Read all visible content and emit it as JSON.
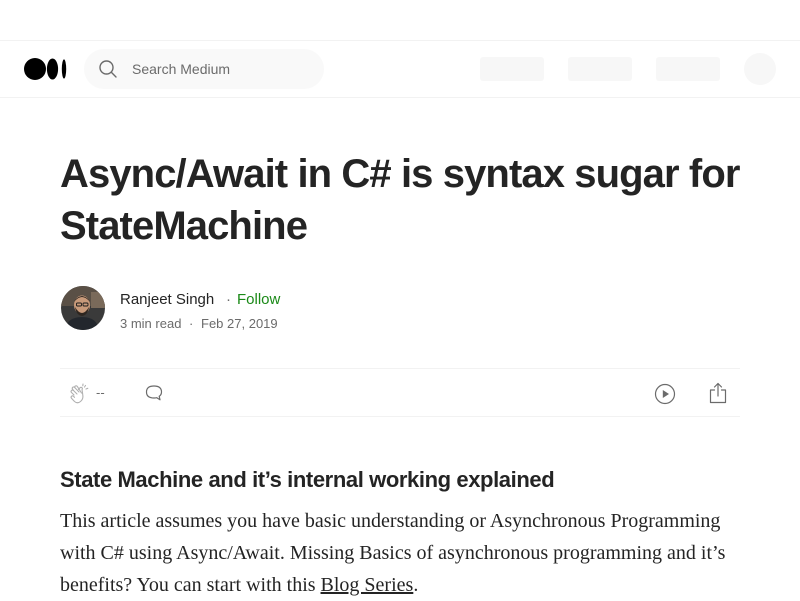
{
  "header": {
    "search_placeholder": "Search Medium"
  },
  "article": {
    "title": "Async/Await in C# is syntax sugar for StateMachine",
    "author": {
      "name": "Ranjeet Singh",
      "separator": "·",
      "follow_label": "Follow"
    },
    "meta": {
      "read_time": "3 min read",
      "separator": "·",
      "date": "Feb 27, 2019"
    },
    "actions": {
      "clap_count": "--"
    },
    "subtitle": "State Machine and it’s internal working explained",
    "body": {
      "text_before_link": "This article assumes you have basic understanding or Asynchronous Programming with C# using Async/Await. Missing Basics of asynchronous programming and it’s benefits? You can start with this ",
      "link_text": "Blog Series",
      "text_after_link": "."
    }
  },
  "icons": {
    "logo": "medium-logo",
    "search": "search-icon",
    "clap": "clap-icon",
    "response": "speech-bubble-icon",
    "listen": "play-circle-icon",
    "share": "share-icon"
  },
  "colors": {
    "follow": "#1a8917",
    "text": "#242424",
    "muted": "#6b6b6b"
  }
}
